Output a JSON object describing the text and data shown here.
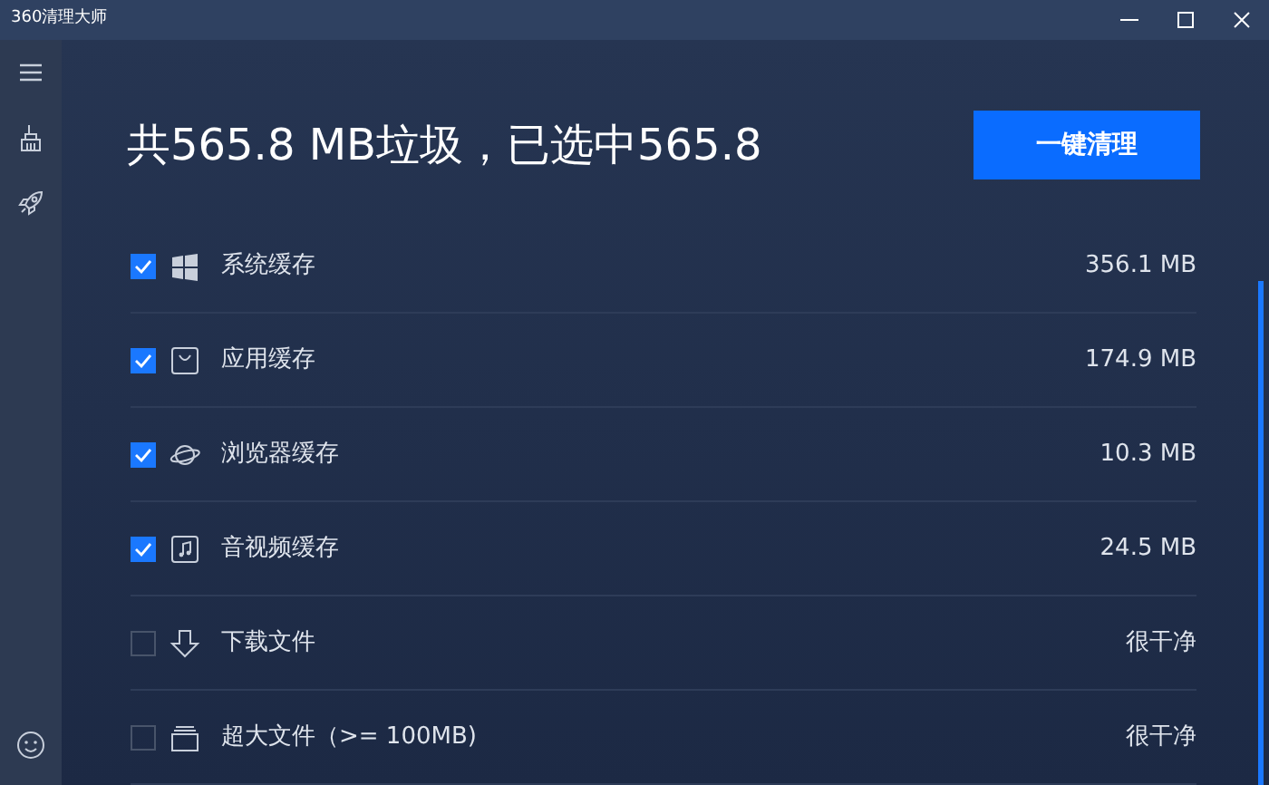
{
  "window": {
    "title": "360清理大师"
  },
  "summary": {
    "headline": "共565.8 MB垃圾，已选中565.8",
    "button": "一键清理"
  },
  "items": [
    {
      "label": "系统缓存",
      "size": "356.1 MB",
      "checked": true
    },
    {
      "label": "应用缓存",
      "size": "174.9 MB",
      "checked": true
    },
    {
      "label": "浏览器缓存",
      "size": "10.3 MB",
      "checked": true
    },
    {
      "label": "音视频缓存",
      "size": "24.5 MB",
      "checked": true
    },
    {
      "label": "下载文件",
      "size": "很干净",
      "checked": false
    },
    {
      "label": "超大文件（>= 100MB)",
      "size": "很干净",
      "checked": false
    }
  ]
}
